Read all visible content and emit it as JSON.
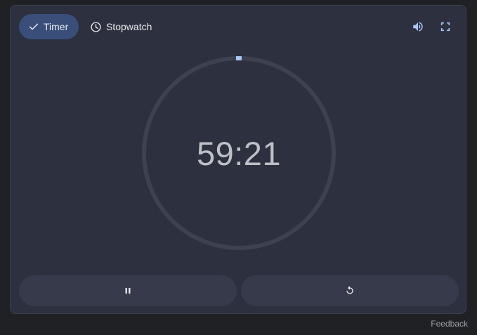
{
  "tabs": {
    "timer": {
      "label": "Timer",
      "selected": true
    },
    "stopwatch": {
      "label": "Stopwatch",
      "selected": false
    }
  },
  "icons": {
    "timer_tab": "check-icon",
    "stopwatch_tab": "clock-icon",
    "sound": "volume-icon",
    "fullscreen": "fullscreen-icon",
    "pause": "pause-icon",
    "reset": "reset-icon"
  },
  "timer": {
    "display": "59:21",
    "progress_remaining": 0.99
  },
  "footer": {
    "feedback_label": "Feedback"
  },
  "colors": {
    "background": "#202124",
    "card": "#2d303e",
    "selected_tab": "#394f7a",
    "ring_track": "#3e4150",
    "ring_indicator": "#a8c7fa",
    "button": "#373a4a",
    "text": "#e8eaed",
    "time_text": "#bdc1c6"
  }
}
